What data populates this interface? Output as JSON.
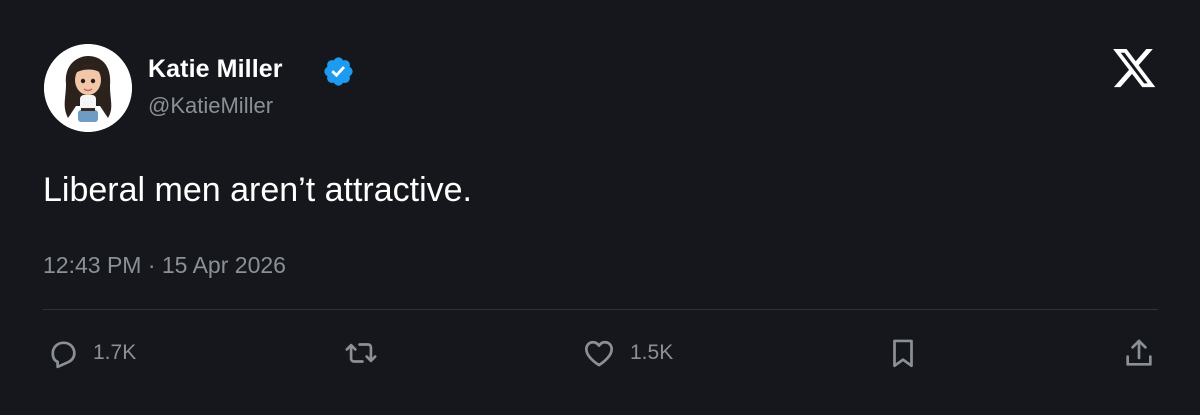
{
  "post": {
    "author": {
      "display_name": "Katie Miller",
      "handle": "@KatieMiller",
      "verified": true,
      "verified_color": "#1d9bf0"
    },
    "text": "Liberal men aren’t attractive.",
    "timestamp": "12:43 PM · 15 Apr 2026",
    "platform_icon": "x-logo-icon"
  },
  "actions": {
    "reply": {
      "icon": "reply-bubble-icon",
      "count": "1.7K"
    },
    "repost": {
      "icon": "repost-arrows-icon"
    },
    "like": {
      "icon": "heart-icon",
      "count": "1.5K"
    },
    "bookmark": {
      "icon": "bookmark-icon"
    },
    "share": {
      "icon": "share-upload-icon"
    }
  }
}
